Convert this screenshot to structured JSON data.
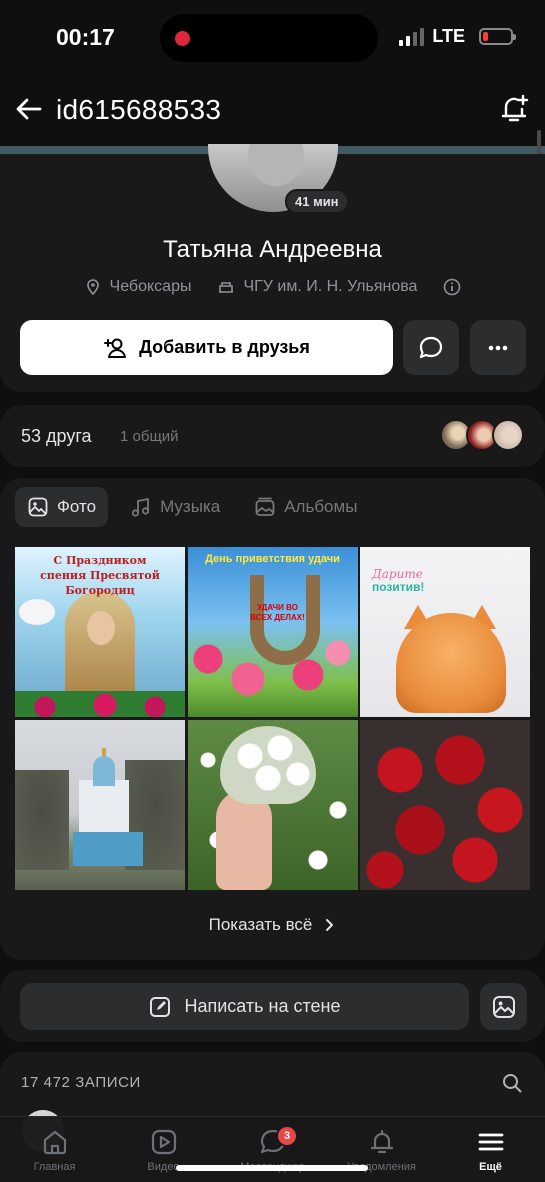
{
  "status_bar": {
    "time": "00:17",
    "network": "LTE"
  },
  "header": {
    "title": "id615688533"
  },
  "profile": {
    "online_badge": "41 мин",
    "name": "Татьяна Андреевна",
    "city": "Чебоксары",
    "university": "ЧГУ им. И. Н. Ульянова",
    "add_friend_label": "Добавить в друзья"
  },
  "friends": {
    "count_label": "53 друга",
    "common_label": "1 общий"
  },
  "media": {
    "tabs": [
      {
        "label": "Фото",
        "icon": "photo-icon",
        "active": true
      },
      {
        "label": "Музыка",
        "icon": "music-note-icon",
        "active": false
      },
      {
        "label": "Альбомы",
        "icon": "albums-icon",
        "active": false
      }
    ],
    "photos": [
      {
        "caption_1": "С Праздником",
        "caption_2": "спения Пресвятой Богородиц"
      },
      {
        "caption": "День приветствия удачи",
        "sub": "УДАЧИ ВО ВСЕХ ДЕЛАХ!"
      },
      {
        "caption_1": "Дарите",
        "caption_2": "позитив!"
      }
    ],
    "show_all": "Показать всё"
  },
  "wall": {
    "post_label": "Написать на стене"
  },
  "posts": {
    "count_label": "17 472 ЗАПИСИ"
  },
  "tabbar": {
    "items": [
      {
        "label": "Главная",
        "icon": "home-icon"
      },
      {
        "label": "Видео",
        "icon": "video-icon"
      },
      {
        "label": "Мессенджер",
        "icon": "messenger-icon",
        "badge": "3"
      },
      {
        "label": "Уведомления",
        "icon": "bell-icon"
      },
      {
        "label": "Ещё",
        "icon": "menu-icon",
        "active": true
      }
    ]
  },
  "colors": {
    "background": "#0f0f10",
    "card": "#19191a",
    "button": "#2c2d2e",
    "badge": "#e64646",
    "accent_strip": "#3f5a63"
  }
}
